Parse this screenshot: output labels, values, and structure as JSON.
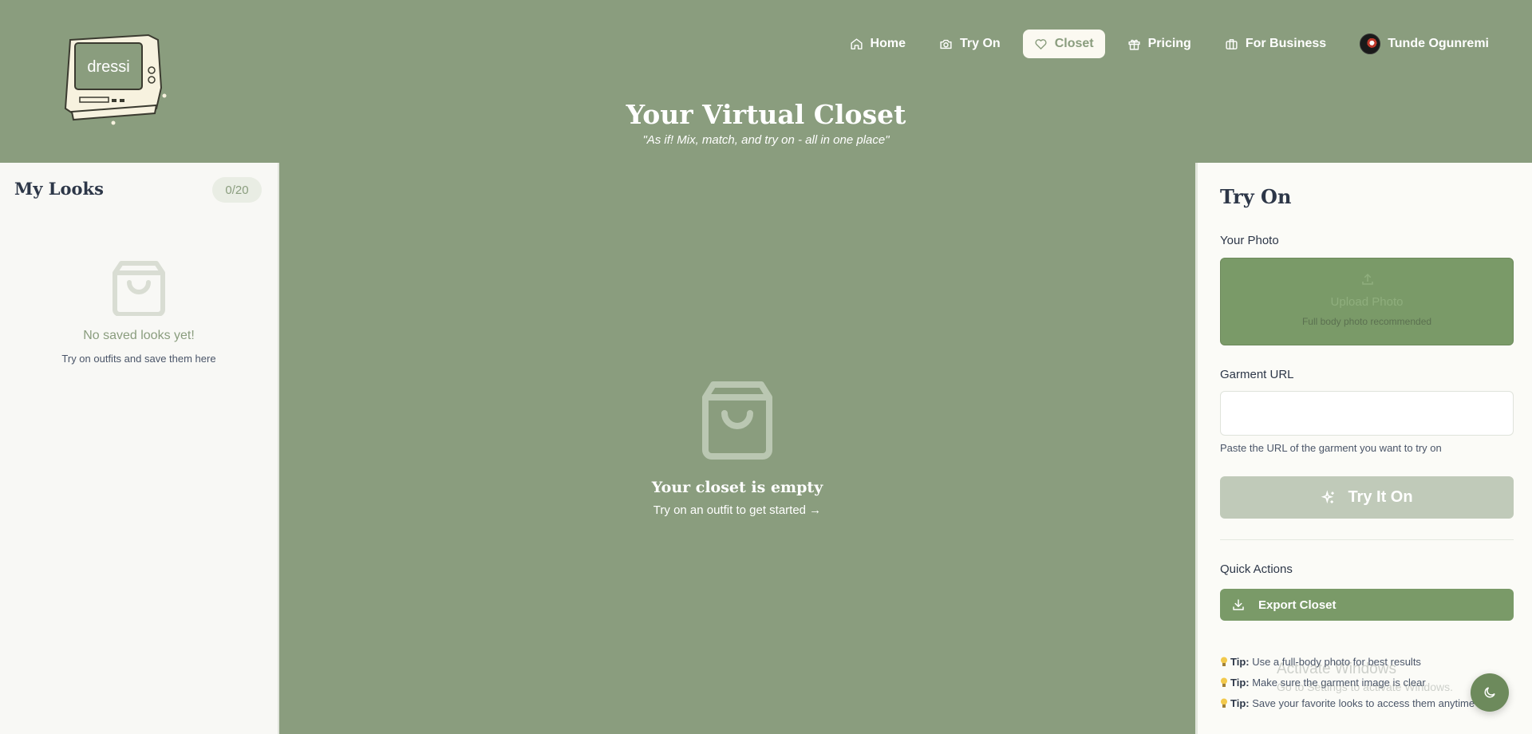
{
  "brand": {
    "logo_text": "dressi"
  },
  "nav": {
    "items": [
      {
        "label": "Home",
        "icon": "home-icon"
      },
      {
        "label": "Try On",
        "icon": "camera-icon"
      },
      {
        "label": "Closet",
        "icon": "heart-icon",
        "active": true
      },
      {
        "label": "Pricing",
        "icon": "gift-icon"
      },
      {
        "label": "For Business",
        "icon": "briefcase-icon"
      }
    ],
    "user_name": "Tunde Ogunremi"
  },
  "header": {
    "title": "Your Virtual Closet",
    "subtitle": "\"As if! Mix, match, and try on - all in one place\""
  },
  "my_looks": {
    "title": "My Looks",
    "count": "0/20",
    "empty_title": "No saved looks yet!",
    "empty_subtitle": "Try on outfits and save them here"
  },
  "closet": {
    "empty_title": "Your closet is empty",
    "empty_subtitle": "Try on an outfit to get started →"
  },
  "try_on": {
    "title": "Try On",
    "photo_label": "Your Photo",
    "upload_label": "Upload Photo",
    "upload_hint": "Full body photo recommended",
    "garment_label": "Garment URL",
    "garment_placeholder": "",
    "garment_hint": "Paste the URL of the garment you want to try on",
    "button_label": "Try It On",
    "quick_actions_label": "Quick Actions",
    "export_label": "Export Closet"
  },
  "tips": [
    {
      "prefix": "Tip:",
      "text": " Use a full-body photo for best results"
    },
    {
      "prefix": "Tip:",
      "text": " Make sure the garment image is clear"
    },
    {
      "prefix": "Tip:",
      "text": " Save your favorite looks to access them anytime"
    }
  ],
  "watermark": {
    "line1": "Activate Windows",
    "line2": "Go to Settings to activate Windows."
  },
  "colors": {
    "sage": "#8a9d7e",
    "green_button": "#7a9a68",
    "panel_bg": "#f8f8f5",
    "cream": "#fbf9f1"
  }
}
